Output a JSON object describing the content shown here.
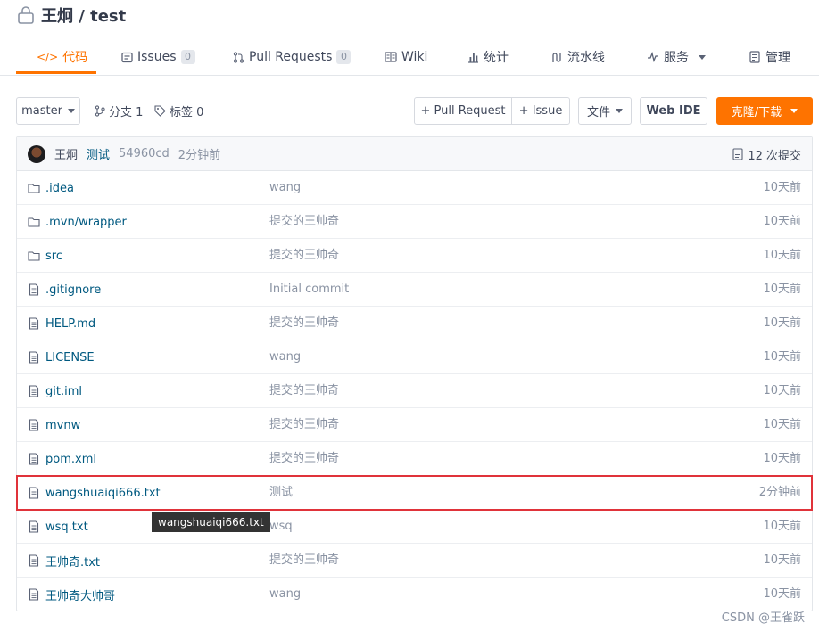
{
  "repo": {
    "title": "王炯 / test"
  },
  "tabs": [
    {
      "icon": "code-icon",
      "label": "代码"
    },
    {
      "icon": "issues-icon",
      "label": "Issues",
      "badge": "0"
    },
    {
      "icon": "pull-request-icon",
      "label": "Pull Requests",
      "badge": "0"
    },
    {
      "icon": "wiki-icon",
      "label": "Wiki"
    },
    {
      "icon": "stats-icon",
      "label": "统计"
    },
    {
      "icon": "pipeline-icon",
      "label": "流水线"
    },
    {
      "icon": "services-icon",
      "label": "服务"
    },
    {
      "icon": "manage-icon",
      "label": "管理"
    }
  ],
  "toolbar": {
    "branch": "master",
    "branches_label": "分支 1",
    "tags_label": "标签 0",
    "pull_request": "+ Pull Request",
    "issue": "+ Issue",
    "files": "文件",
    "web_ide": "Web IDE",
    "clone": "克隆/下载"
  },
  "commit": {
    "author": "王炯",
    "message": "测试",
    "hash": "54960cd",
    "time": "2分钟前",
    "count": "12 次提交"
  },
  "files": [
    {
      "type": "folder",
      "name": ".idea",
      "message": "wang",
      "time": "10天前"
    },
    {
      "type": "folder",
      "name": ".mvn/wrapper",
      "message": "提交的王帅奇",
      "time": "10天前"
    },
    {
      "type": "folder",
      "name": "src",
      "message": "提交的王帅奇",
      "time": "10天前"
    },
    {
      "type": "file",
      "name": ".gitignore",
      "message": "Initial commit",
      "time": "10天前"
    },
    {
      "type": "file",
      "name": "HELP.md",
      "message": "提交的王帅奇",
      "time": "10天前"
    },
    {
      "type": "file",
      "name": "LICENSE",
      "message": "wang",
      "time": "10天前"
    },
    {
      "type": "file",
      "name": "git.iml",
      "message": "提交的王帅奇",
      "time": "10天前"
    },
    {
      "type": "file",
      "name": "mvnw",
      "message": "提交的王帅奇",
      "time": "10天前"
    },
    {
      "type": "file",
      "name": "pom.xml",
      "message": "提交的王帅奇",
      "time": "10天前"
    },
    {
      "type": "file",
      "name": "wangshuaiqi666.txt",
      "message": "测试",
      "time": "2分钟前"
    },
    {
      "type": "file",
      "name": "wsq.txt",
      "message": "wsq",
      "time": "10天前"
    },
    {
      "type": "file",
      "name": "王帅奇.txt",
      "message": "提交的王帅奇",
      "time": "10天前"
    },
    {
      "type": "file",
      "name": "王帅奇大帅哥",
      "message": "wang",
      "time": "10天前"
    }
  ],
  "tooltip": "wangshuaiqi666.txt",
  "watermark": "CSDN @王雀跃",
  "colors": {
    "accent": "#fe7300",
    "link": "#005980",
    "highlight": "#e0333a"
  }
}
